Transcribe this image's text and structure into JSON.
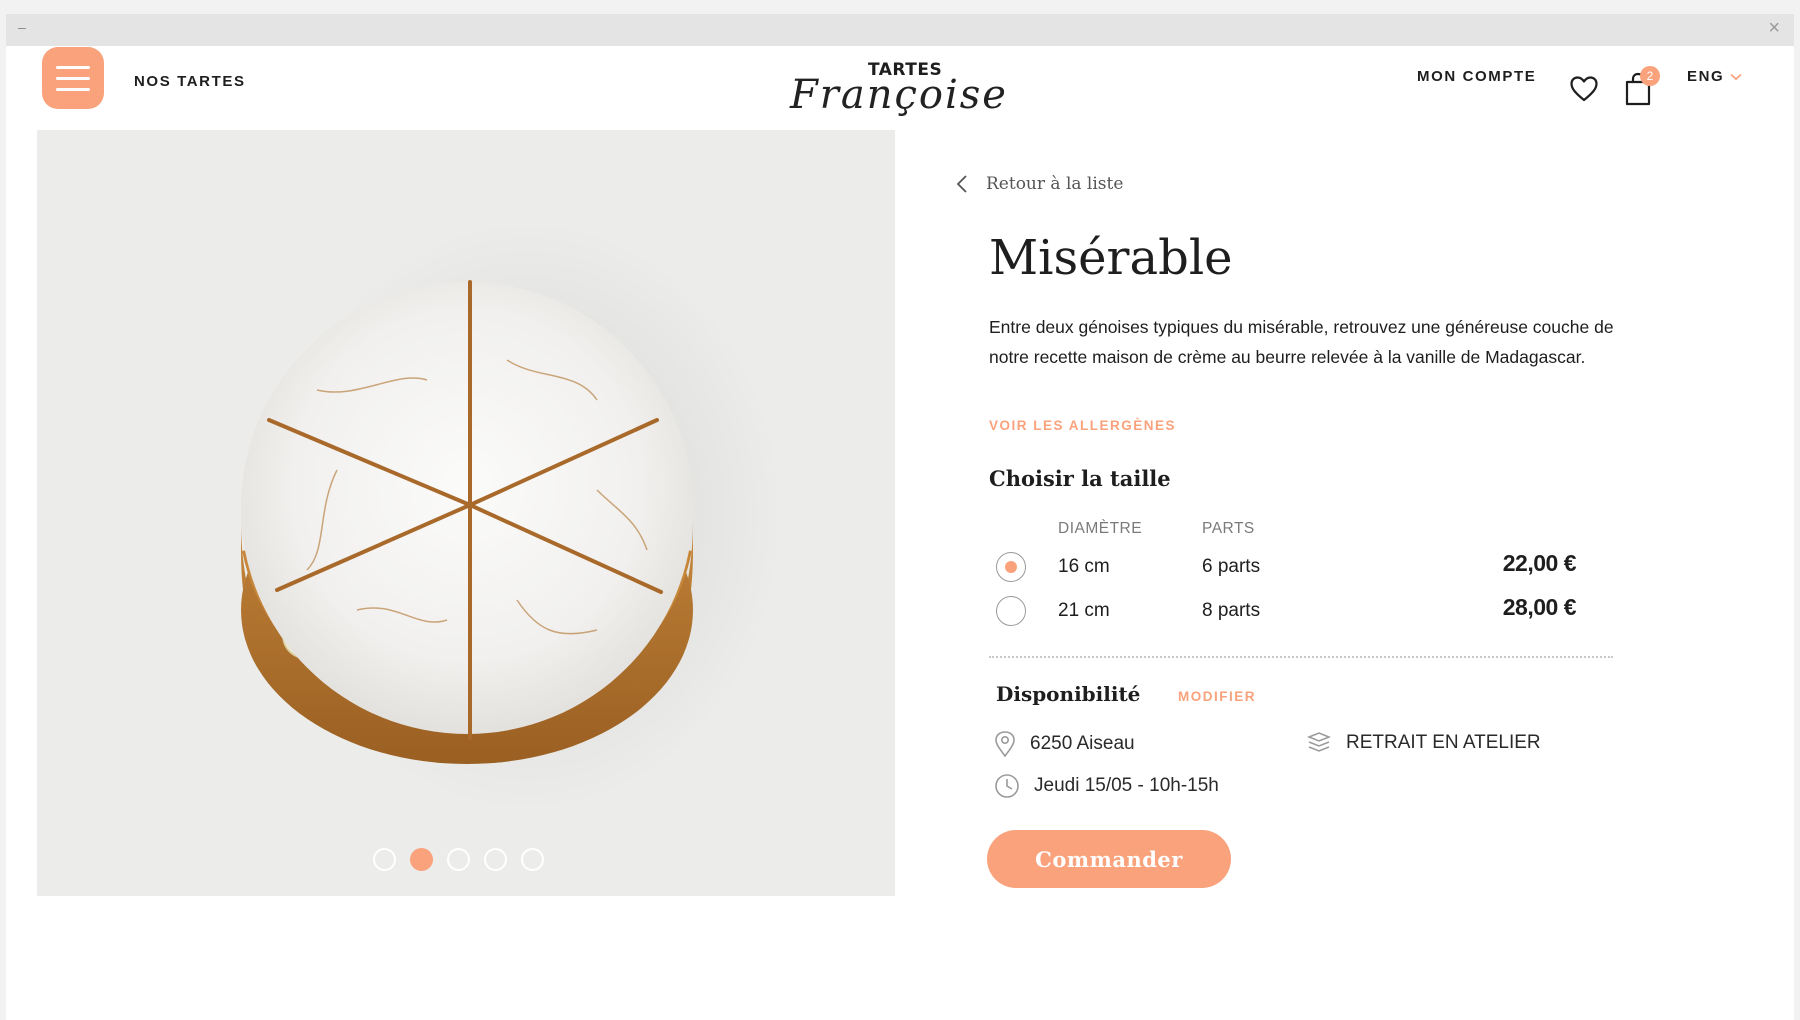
{
  "header": {
    "nav_label": "NOS TARTES",
    "logo_top": "TARTES",
    "logo_script": "Françoise",
    "account_label": "MON COMPTE",
    "cart_count": "2",
    "language": "ENG",
    "accent_color": "#f9a27c"
  },
  "gallery": {
    "slide_count": 5,
    "active_index": 1
  },
  "product": {
    "back_label": "Retour à la liste",
    "title": "Misérable",
    "description": "Entre deux génoises typiques du misérable, retrouvez une généreuse couche de notre recette maison de crème au beurre relevée à la vanille de Madagascar.",
    "allergens_link": "VOIR LES ALLERGÈNES",
    "size_title": "Choisir la taille",
    "size_table": {
      "header_diameter": "DIAMÈTRE",
      "header_parts": "PARTS",
      "options": [
        {
          "diameter": "16 cm",
          "parts": "6 parts",
          "price": "22,00 €",
          "selected": true
        },
        {
          "diameter": "21 cm",
          "parts": "8 parts",
          "price": "28,00 €",
          "selected": false
        }
      ]
    },
    "availability": {
      "title": "Disponibilité",
      "modify_label": "MODIFIER",
      "location": "6250 Aiseau",
      "pickup_mode": "RETRAIT EN ATELIER",
      "slot": "Jeudi 15/05 - 10h-15h"
    },
    "order_button": "Commander"
  },
  "icons": [
    "menu-icon",
    "heart-icon",
    "bag-icon",
    "chevron-down-icon",
    "chevron-left-icon",
    "location-pin-icon",
    "clock-icon",
    "pickup-icon",
    "close-icon"
  ]
}
